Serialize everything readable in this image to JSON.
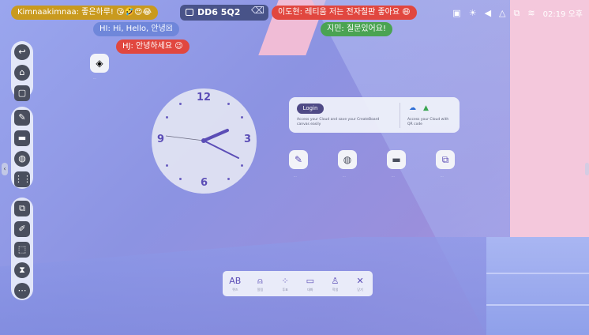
{
  "status_bar": {
    "chat_left": "Kimnaakimnaa: 좋은하루! 😘🤣😍😂",
    "board_title": "DD6 5Q2",
    "chat_right_top": "이도현: 레티움 저는 전자칠판 좋아요 😄",
    "chat_hi": "HI: Hi, Hello, 안녕☒",
    "chat_green": "지민: 질문있어요!",
    "chat_red": "HJ: 안녕하세요 😉",
    "time": "02:19 오후"
  },
  "tray_icons": [
    "window-icon",
    "brightness-icon",
    "volume-icon",
    "cloud-icon",
    "network-icon",
    "wifi-icon"
  ],
  "sidebar": {
    "top": [
      "back-icon",
      "home-icon",
      "recent-apps-icon"
    ],
    "middle": [
      "whiteboard-icon",
      "folder-icon",
      "browser-icon",
      "apps-grid-icon"
    ],
    "bottom": [
      "screen-share-icon",
      "annotate-icon",
      "screenshot-icon",
      "timer-icon",
      "more-icon"
    ]
  },
  "clock": {
    "numbers": {
      "12": "12",
      "3": "3",
      "6": "6",
      "9": "9"
    }
  },
  "login_card": {
    "button": "Login",
    "desc_left": "Access your Cloud and save your CreateBoard canvas easily",
    "desc_right": "Access your Cloud with QR code"
  },
  "desktop_apps": [
    {
      "icon": "share-app-icon",
      "label": "..."
    },
    {
      "icon": "whiteboard-app-icon",
      "label": "..."
    },
    {
      "icon": "browser-app-icon",
      "label": "..."
    },
    {
      "icon": "files-app-icon",
      "label": "..."
    },
    {
      "icon": "screen-share-app-icon",
      "label": "..."
    }
  ],
  "toolbar": [
    {
      "icon": "ab-icon",
      "label": "퀴즈"
    },
    {
      "icon": "bell-icon",
      "label": "알림"
    },
    {
      "icon": "grid-icon",
      "label": "투표"
    },
    {
      "icon": "chat-icon",
      "label": "대화"
    },
    {
      "icon": "user-add-icon",
      "label": "학생"
    },
    {
      "icon": "close-icon",
      "label": "닫기"
    }
  ],
  "colors": {
    "accent": "#5b4db6",
    "gold_chip": "#c99a1e",
    "red_chip": "#e1473f",
    "green_chip": "#4aa352"
  }
}
